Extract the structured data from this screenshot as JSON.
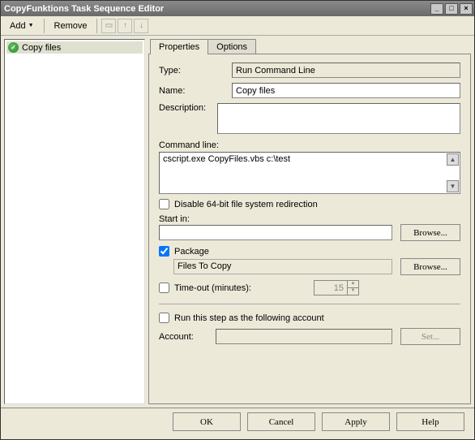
{
  "window": {
    "title": "CopyFunktions Task Sequence Editor"
  },
  "toolbar": {
    "add": "Add",
    "remove": "Remove"
  },
  "tree": {
    "items": [
      {
        "label": "Copy files"
      }
    ]
  },
  "tabs": {
    "properties": "Properties",
    "options": "Options"
  },
  "form": {
    "type_label": "Type:",
    "type_value": "Run Command Line",
    "name_label": "Name:",
    "name_value": "Copy files",
    "description_label": "Description:",
    "description_value": "",
    "cmdline_label": "Command line:",
    "cmdline_value": "cscript.exe CopyFiles.vbs c:\\test",
    "disable64_label": "Disable 64-bit file system redirection",
    "disable64_checked": false,
    "startin_label": "Start in:",
    "startin_value": "",
    "browse1": "Browse...",
    "package_label": "Package",
    "package_checked": true,
    "package_name": "Files To Copy",
    "browse2": "Browse...",
    "timeout_label": "Time-out (minutes):",
    "timeout_checked": false,
    "timeout_value": "15",
    "runas_label": "Run this step as the following account",
    "runas_checked": false,
    "account_label": "Account:",
    "account_value": "",
    "set_btn": "Set..."
  },
  "buttons": {
    "ok": "OK",
    "cancel": "Cancel",
    "apply": "Apply",
    "help": "Help"
  }
}
